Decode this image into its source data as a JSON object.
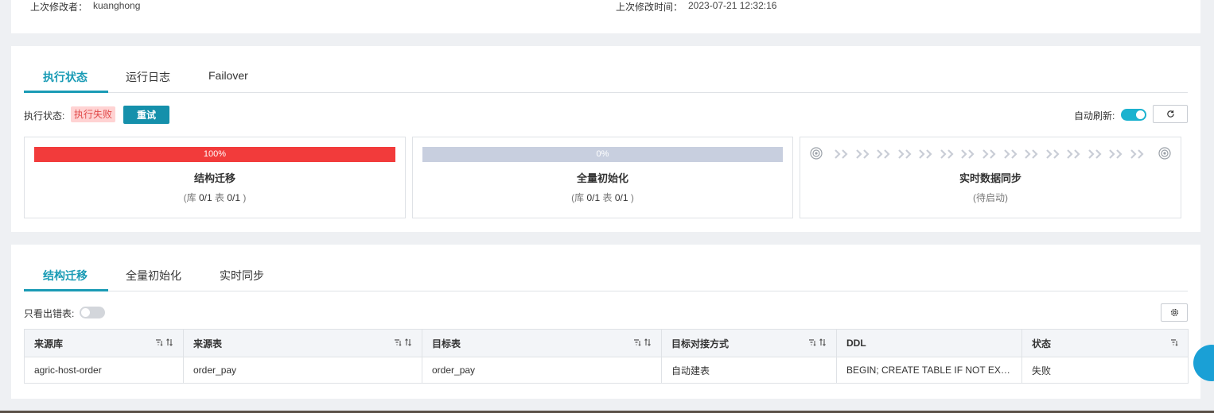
{
  "meta": {
    "modifier_label": "上次修改者：",
    "modifier_value": "kuanghong",
    "modified_time_label": "上次修改时间：",
    "modified_time_value": "2023-07-21 12:32:16"
  },
  "exec_tabs": [
    {
      "label": "执行状态",
      "active": true
    },
    {
      "label": "运行日志",
      "active": false
    },
    {
      "label": "Failover",
      "active": false
    }
  ],
  "status": {
    "label": "执行状态:",
    "badge": "执行失败",
    "retry_button": "重试",
    "auto_refresh_label": "自动刷新:",
    "auto_refresh_on": true,
    "refresh_icon": "refresh-icon"
  },
  "stages": {
    "structure": {
      "progress": 100,
      "progress_text": "100%",
      "title": "结构迁移",
      "sub_db_label": "库",
      "sub_db": "0/1",
      "sub_tbl_label": "表",
      "sub_tbl": "0/1"
    },
    "full_init": {
      "progress": 0,
      "progress_text": "0%",
      "title": "全量初始化",
      "sub_db_label": "库",
      "sub_db": "0/1",
      "sub_tbl_label": "表",
      "sub_tbl": "0/1"
    },
    "realtime": {
      "title": "实时数据同步",
      "sub": "(待启动)"
    }
  },
  "mig_tabs": [
    {
      "label": "结构迁移",
      "active": true
    },
    {
      "label": "全量初始化",
      "active": false
    },
    {
      "label": "实时同步",
      "active": false
    }
  ],
  "filter": {
    "only_error_label": "只看出错表:",
    "only_error_on": false
  },
  "table": {
    "columns": [
      "来源库",
      "来源表",
      "目标表",
      "目标对接方式",
      "DDL",
      "状态"
    ],
    "rows": [
      [
        "agric-host-order",
        "order_pay",
        "order_pay",
        "自动建表",
        "BEGIN; CREATE TABLE IF NOT EXISTS order_pay",
        "失败"
      ]
    ]
  },
  "colors": {
    "accent": "#1a9bb5",
    "danger": "#f23b3b",
    "pending": "#c8cfdf"
  }
}
